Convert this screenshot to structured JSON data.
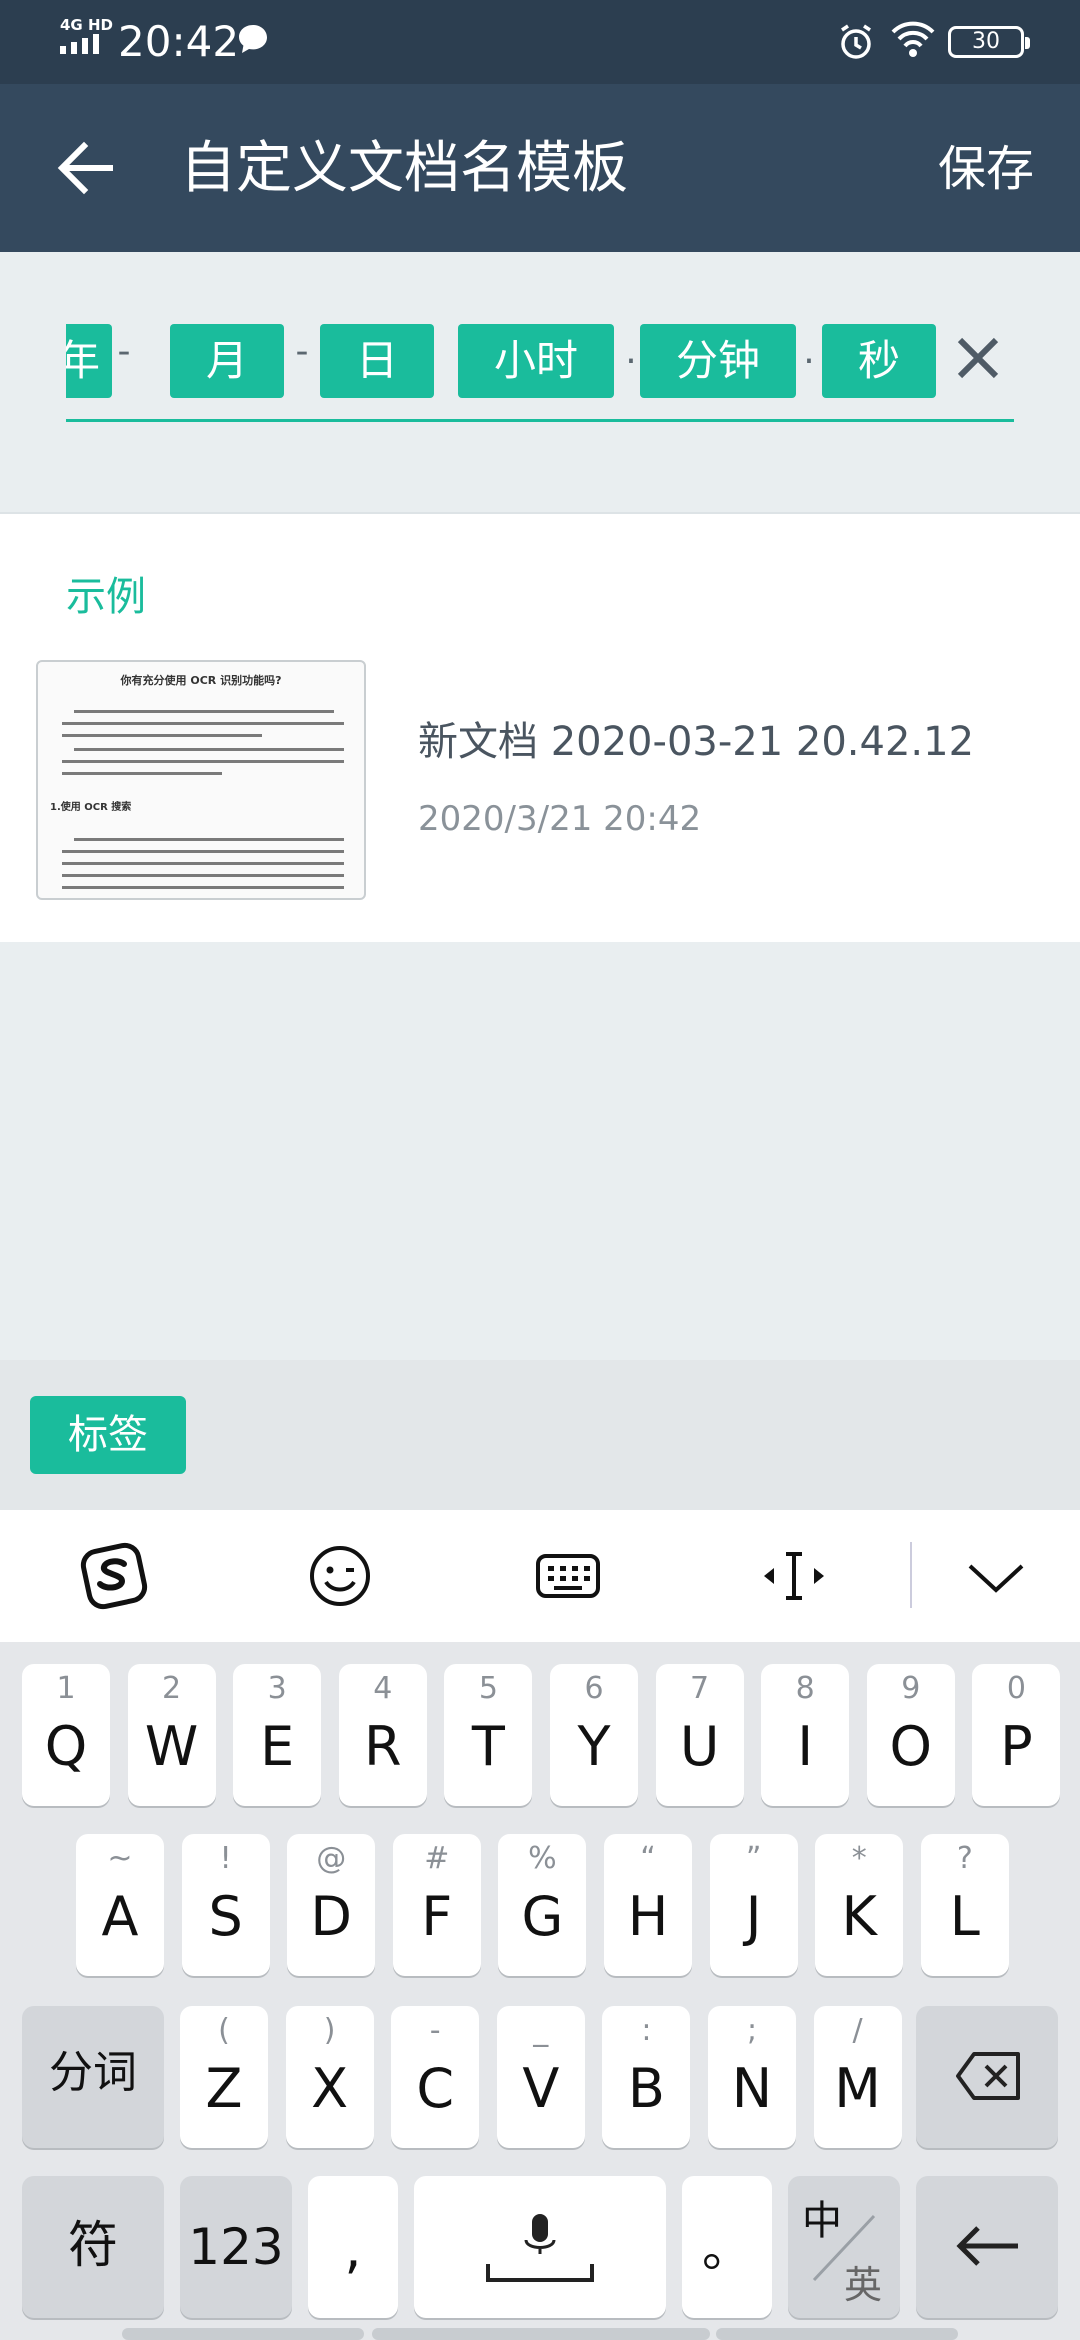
{
  "status_bar": {
    "network": "4G HD",
    "time": "20:42",
    "battery": "30"
  },
  "app_bar": {
    "title": "自定义文档名模板",
    "save_label": "保存"
  },
  "template_tokens": [
    {
      "label": "年"
    },
    {
      "separator": "-"
    },
    {
      "label": "月"
    },
    {
      "separator": "-"
    },
    {
      "label": "日"
    },
    {
      "label": "小时"
    },
    {
      "separator": "."
    },
    {
      "label": "分钟"
    },
    {
      "separator": "."
    },
    {
      "label": "秒"
    }
  ],
  "example": {
    "section_label": "示例",
    "thumbnail_title": "你有充分使用 OCR 识别功能吗?",
    "thumbnail_heading": "1.使用 OCR 搜索",
    "document_name": "新文档 2020-03-21 20.42.12",
    "document_date": "2020/3/21 20:42"
  },
  "tag_button_label": "标签",
  "keyboard": {
    "row1": [
      {
        "main": "Q",
        "sub": "1"
      },
      {
        "main": "W",
        "sub": "2"
      },
      {
        "main": "E",
        "sub": "3"
      },
      {
        "main": "R",
        "sub": "4"
      },
      {
        "main": "T",
        "sub": "5"
      },
      {
        "main": "Y",
        "sub": "6"
      },
      {
        "main": "U",
        "sub": "7"
      },
      {
        "main": "I",
        "sub": "8"
      },
      {
        "main": "O",
        "sub": "9"
      },
      {
        "main": "P",
        "sub": "0"
      }
    ],
    "row2": [
      {
        "main": "A",
        "sub": "~"
      },
      {
        "main": "S",
        "sub": "!"
      },
      {
        "main": "D",
        "sub": "@"
      },
      {
        "main": "F",
        "sub": "#"
      },
      {
        "main": "G",
        "sub": "%"
      },
      {
        "main": "H",
        "sub": "“"
      },
      {
        "main": "J",
        "sub": "”"
      },
      {
        "main": "K",
        "sub": "*"
      },
      {
        "main": "L",
        "sub": "?"
      }
    ],
    "row3": [
      {
        "main": "Z",
        "sub": "("
      },
      {
        "main": "X",
        "sub": ")"
      },
      {
        "main": "C",
        "sub": "-"
      },
      {
        "main": "V",
        "sub": "_"
      },
      {
        "main": "B",
        "sub": ":"
      },
      {
        "main": "N",
        "sub": ";"
      },
      {
        "main": "M",
        "sub": "/"
      }
    ],
    "segment_label": "分词",
    "symbol_label": "符",
    "numeric_label": "123",
    "comma_label": ",",
    "period_label": "。",
    "lang_zh": "中",
    "lang_en": "英"
  }
}
